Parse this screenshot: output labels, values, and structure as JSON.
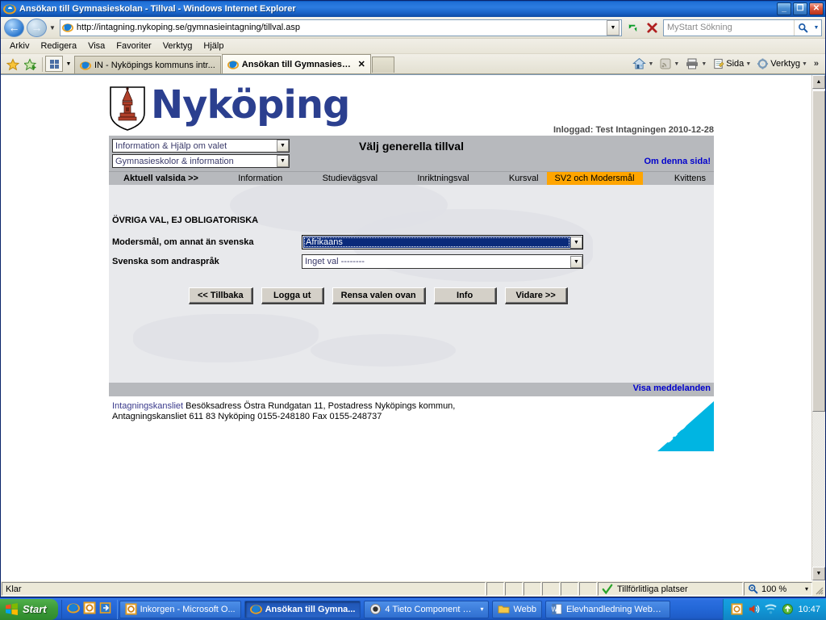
{
  "window": {
    "title": "Ansökan till Gymnasieskolan - Tillval - Windows Internet Explorer",
    "minimize_label": "_",
    "maximize_label": "❐",
    "close_label": "✕"
  },
  "address_bar": {
    "url": "http://intagning.nykoping.se/gymnasieintagning/tillval.asp",
    "refresh_label": "↻",
    "stop_label": "✕",
    "search_placeholder": "MyStart Sökning",
    "search_value": "",
    "search_icon": "search-icon",
    "go_label": "→"
  },
  "menu_bar": {
    "items": [
      {
        "label": "Arkiv"
      },
      {
        "label": "Redigera"
      },
      {
        "label": "Visa"
      },
      {
        "label": "Favoriter"
      },
      {
        "label": "Verktyg"
      },
      {
        "label": "Hjälp"
      }
    ]
  },
  "tab_bar": {
    "favorites_label": "★",
    "add_favorite_label": "✚",
    "tabs": [
      {
        "label": "IN - Nyköpings kommuns intr...",
        "active": false
      },
      {
        "label": "Ansökan till Gymnasieskol...",
        "active": true,
        "close_label": "✕"
      }
    ],
    "commands": [
      {
        "label": "",
        "icon": "home-icon"
      },
      {
        "label": "",
        "icon": "feeds-icon"
      },
      {
        "label": "",
        "icon": "print-icon"
      },
      {
        "label": "Sida",
        "icon": "page-icon"
      },
      {
        "label": "Verktyg",
        "icon": "tools-icon"
      }
    ],
    "overflow_label": "»"
  },
  "page": {
    "brand": "Nyköping",
    "login_info": "Inloggad: Test Intagningen   2010-12-28",
    "header_selects": [
      {
        "value": "Information & Hjälp om valet"
      },
      {
        "value": "Gymnasieskolor & information"
      }
    ],
    "title": "Välj generella tillval",
    "about_link": "Om denna sida!",
    "nav": [
      {
        "label": "Aktuell valsida >>",
        "state": "current"
      },
      {
        "label": "Information",
        "state": "normal"
      },
      {
        "label": "Studievägsval",
        "state": "normal"
      },
      {
        "label": "Inriktningsval",
        "state": "normal"
      },
      {
        "label": "Kursval",
        "state": "normal"
      },
      {
        "label": "SV2 och Modersmål",
        "state": "active"
      },
      {
        "label": "Kvittens",
        "state": "normal"
      }
    ],
    "section_title": "ÖVRIGA VAL, EJ OBLIGATORISKA",
    "fields": [
      {
        "label": "Modersmål, om annat än svenska",
        "value": "Afrikaans",
        "focused": true
      },
      {
        "label": "Svenska som andraspråk",
        "value": "Inget val --------",
        "focused": false
      }
    ],
    "buttons": [
      {
        "label": "<< Tillbaka"
      },
      {
        "label": "Logga ut"
      },
      {
        "label": "Rensa valen ovan"
      },
      {
        "label": "Info"
      },
      {
        "label": "Vidare  >>"
      }
    ],
    "messages_link": "Visa meddelanden",
    "footer_lines": [
      {
        "highlight": "Intagningskansliet",
        "rest": "  Besöksadress Östra Rundgatan 11, Postadress Nyköpings kommun,"
      },
      {
        "highlight": "",
        "rest": "Antagningskansliet   611 83 Nyköping   0155-248180   Fax 0155-248737"
      }
    ],
    "logo_text": "tieto",
    "accent_orange": "#ffa500",
    "accent_blue": "#2b3f8f",
    "tieto_cyan": "#00b5e2"
  },
  "scrollbar": {
    "up_label": "▲",
    "down_label": "▼"
  },
  "status_bar": {
    "status": "Klar",
    "zone": "Tillförlitliga platser",
    "zone_icon": "check-icon",
    "zoom": "100 %",
    "zoom_icon": "zoom-icon",
    "zoom_arrow": "▾"
  },
  "taskbar": {
    "start_label": "Start",
    "quick_launch": [
      {
        "icon": "ie-icon"
      },
      {
        "icon": "outlook-icon"
      },
      {
        "icon": "show-desktop-icon"
      }
    ],
    "buttons": [
      {
        "label": "Inkorgen - Microsoft O...",
        "icon": "outlook-icon",
        "active": false
      },
      {
        "label": "Ansökan till Gymna...",
        "icon": "ie-icon",
        "active": true
      },
      {
        "label": "4 Tieto Component M...",
        "icon": "app-icon",
        "active": false,
        "arrow": "▾"
      },
      {
        "label": "Webb",
        "icon": "folder-icon",
        "active": false
      },
      {
        "label": "Elevhandledning Webb...",
        "icon": "word-icon",
        "active": false
      }
    ],
    "tray_icons": [
      "clock-icon",
      "volume-icon",
      "network-icon",
      "update-icon"
    ],
    "clock": "10:47"
  }
}
